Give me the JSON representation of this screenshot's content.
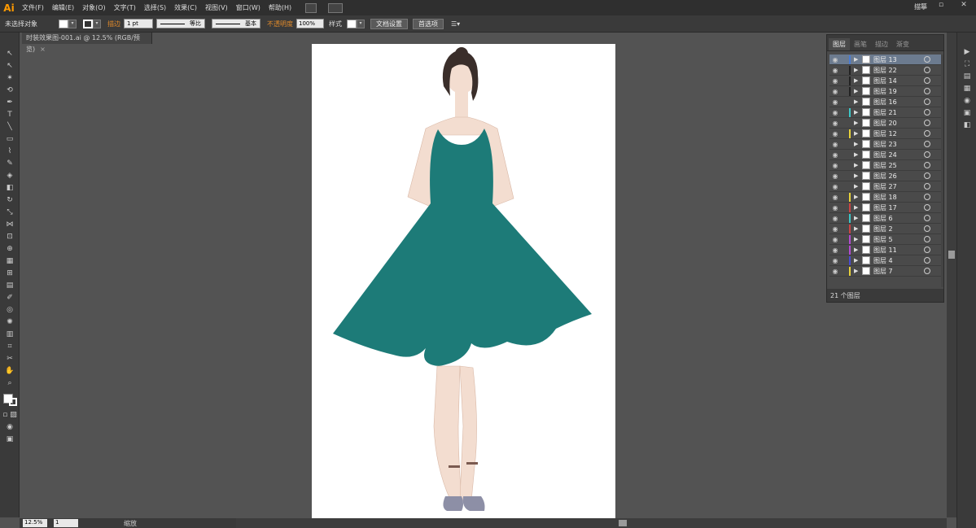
{
  "app": {
    "logo": "Ai",
    "workspace": "描摹",
    "tab_title": "时装效果图-001.ai @ 12.5% (RGB/预览)",
    "tab_close": "×"
  },
  "menu": [
    "文件(F)",
    "编辑(E)",
    "对象(O)",
    "文字(T)",
    "选择(S)",
    "效果(C)",
    "视图(V)",
    "窗口(W)",
    "帮助(H)"
  ],
  "control": {
    "selection_label": "未选择对象",
    "stroke_label": "描边",
    "stroke_weight": "1 pt",
    "profile": "等比",
    "brush": "基本",
    "opacity_label": "不透明度",
    "opacity_value": "100%",
    "style_label": "样式",
    "doc_setup": "文档设置",
    "preferences": "首选项"
  },
  "status": {
    "zoom": "12.5%",
    "page": "1",
    "text": "缩放"
  },
  "layers_panel": {
    "tabs": [
      "图层",
      "画笔",
      "描边",
      "渐变"
    ],
    "footer": "21 个图层",
    "layers": [
      {
        "name": "图层 13",
        "color": "#4a7bd1",
        "selected": true
      },
      {
        "name": "图层 22",
        "color": "#222222"
      },
      {
        "name": "图层 14",
        "color": "#222222"
      },
      {
        "name": "图层 19",
        "color": "#222222"
      },
      {
        "name": "图层 16",
        "color": "#4a4a4a"
      },
      {
        "name": "图层 21",
        "color": "#3cc7c7"
      },
      {
        "name": "图层 20",
        "color": "#4a4a4a"
      },
      {
        "name": "图层 12",
        "color": "#e8d23a"
      },
      {
        "name": "图层 23",
        "color": "#4a4a4a"
      },
      {
        "name": "图层 24",
        "color": "#4a4a4a"
      },
      {
        "name": "图层 25",
        "color": "#4a4a4a"
      },
      {
        "name": "图层 26",
        "color": "#4a4a4a"
      },
      {
        "name": "图层 27",
        "color": "#4a4a4a"
      },
      {
        "name": "图层 18",
        "color": "#e8d23a"
      },
      {
        "name": "图层 17",
        "color": "#cc4444"
      },
      {
        "name": "图层 6",
        "color": "#3cc7c7"
      },
      {
        "name": "图层 2",
        "color": "#cc4444"
      },
      {
        "name": "图层 5",
        "color": "#b44ad1"
      },
      {
        "name": "图层 11",
        "color": "#b44ad1"
      },
      {
        "name": "图层 4",
        "color": "#4a4ad1"
      },
      {
        "name": "图层 7",
        "color": "#e8d23a"
      }
    ]
  },
  "colors": {
    "dress": "#1d7b78",
    "skin": "#f3ddd0",
    "hair": "#3a2e2a"
  }
}
